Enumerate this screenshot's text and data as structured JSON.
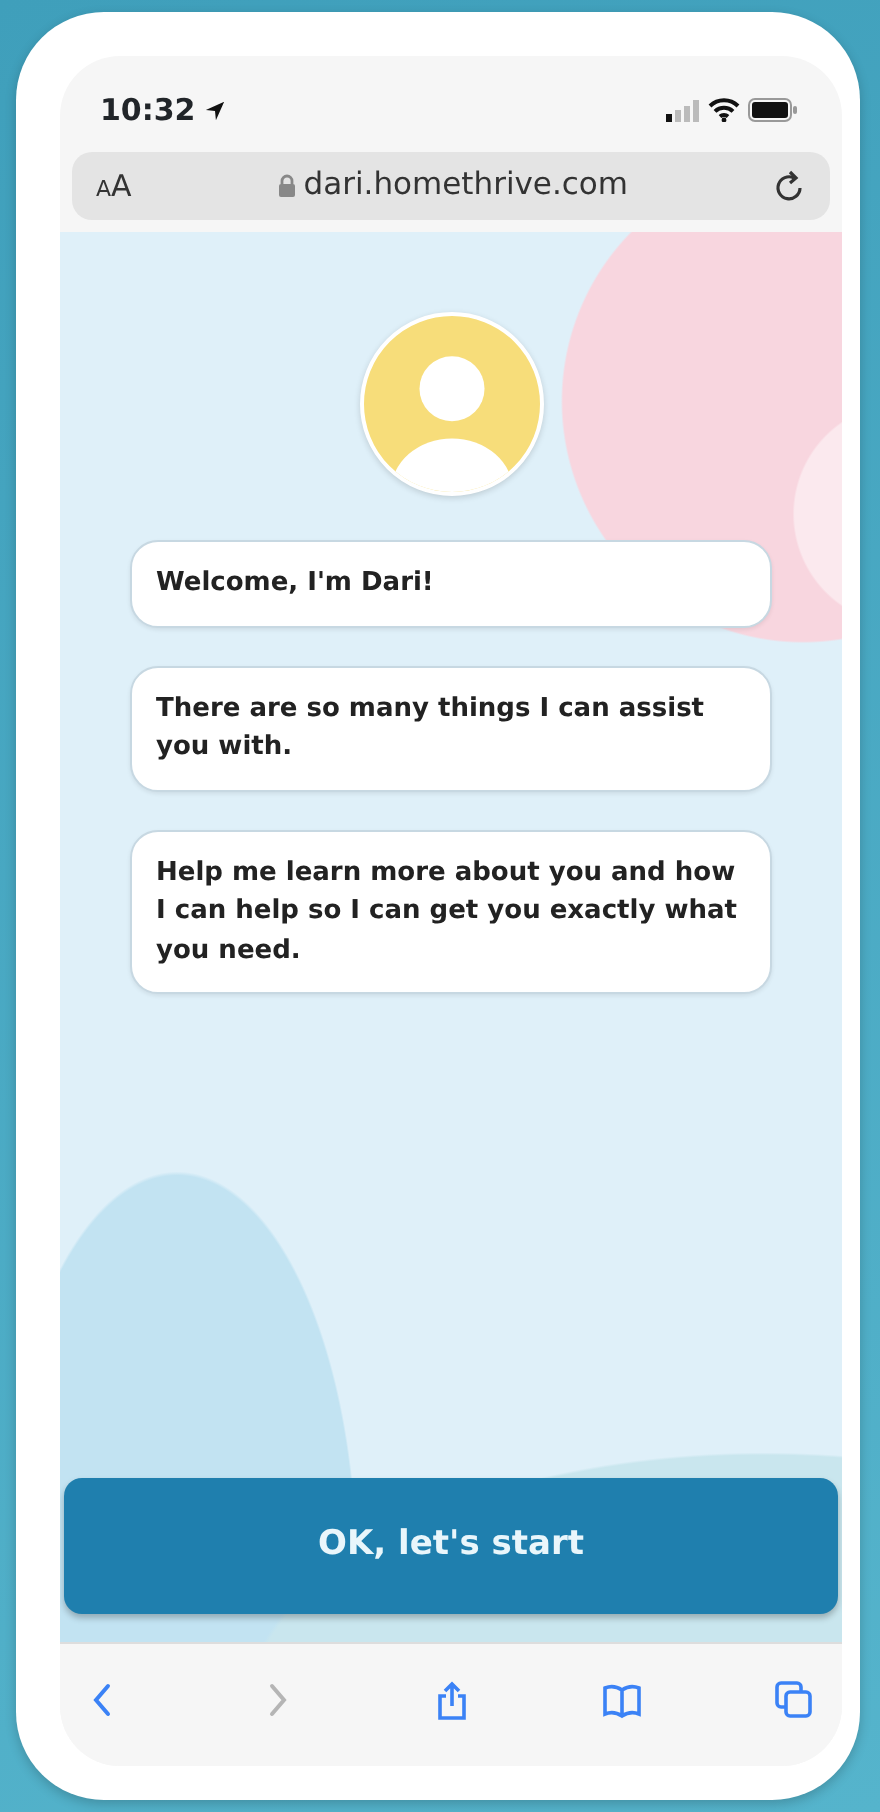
{
  "status_bar": {
    "time": "10:32"
  },
  "address_bar": {
    "text_size": "AA",
    "url": "dari.homethrive.com"
  },
  "messages": [
    {
      "text": "Welcome, I'm Dari!"
    },
    {
      "text": "There are so many things I can assist you with."
    },
    {
      "text": "Help me learn more about you and how I can help so I can get you exactly what you need."
    }
  ],
  "start_button": {
    "label": "OK, let's start"
  },
  "toolbar": [
    {
      "kind": "back",
      "disabled": false
    },
    {
      "kind": "forward",
      "disabled": true
    },
    {
      "kind": "share",
      "disabled": false
    },
    {
      "kind": "bookmarks",
      "disabled": false
    },
    {
      "kind": "tabs",
      "disabled": false
    }
  ]
}
